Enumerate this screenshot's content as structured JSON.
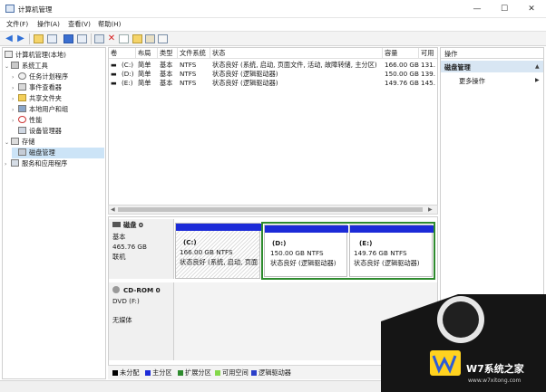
{
  "window": {
    "title": "计算机管理",
    "controls": {
      "minimize": "—",
      "maximize": "☐",
      "close": "✕"
    }
  },
  "menubar": {
    "items": [
      {
        "label": "文件(F)"
      },
      {
        "label": "操作(A)"
      },
      {
        "label": "查看(V)"
      },
      {
        "label": "帮助(H)"
      }
    ]
  },
  "toolbar": {
    "back_glyph": "◀",
    "forward_glyph": "▶",
    "delete_glyph": "✕",
    "icons": [
      "back-icon",
      "forward-icon",
      "up-folder-icon",
      "show-hide-tree-icon",
      "help-icon",
      "properties-icon",
      "connect-icon",
      "delete-icon",
      "check-icon",
      "open-icon",
      "help-book-icon",
      "view-icon"
    ]
  },
  "tree": {
    "items": [
      {
        "label": "计算机管理(本地)",
        "level": 0,
        "expander": "",
        "icon": "computer-icon",
        "selected": false
      },
      {
        "label": "系统工具",
        "level": 1,
        "expander": "⌄",
        "icon": "tools-icon",
        "selected": false
      },
      {
        "label": "任务计划程序",
        "level": 2,
        "expander": "›",
        "icon": "clock-icon",
        "selected": false
      },
      {
        "label": "事件查看器",
        "level": 2,
        "expander": "›",
        "icon": "event-icon",
        "selected": false
      },
      {
        "label": "共享文件夹",
        "level": 2,
        "expander": "›",
        "icon": "folder-icon",
        "selected": false
      },
      {
        "label": "本地用户和组",
        "level": 2,
        "expander": "›",
        "icon": "users-icon",
        "selected": false
      },
      {
        "label": "性能",
        "level": 2,
        "expander": "›",
        "icon": "performance-icon",
        "selected": false
      },
      {
        "label": "设备管理器",
        "level": 2,
        "expander": "",
        "icon": "device-icon",
        "selected": false
      },
      {
        "label": "存储",
        "level": 1,
        "expander": "⌄",
        "icon": "storage-icon",
        "selected": false
      },
      {
        "label": "磁盘管理",
        "level": 2,
        "expander": "",
        "icon": "disk-icon",
        "selected": true
      },
      {
        "label": "服务和应用程序",
        "level": 1,
        "expander": "›",
        "icon": "services-icon",
        "selected": false
      }
    ]
  },
  "volumes": {
    "columns": [
      "卷",
      "布局",
      "类型",
      "文件系统",
      "状态",
      "容量",
      "可用"
    ],
    "rows": [
      [
        "(C:)",
        "简单",
        "基本",
        "NTFS",
        "状态良好 (系统, 启动, 页面文件, 活动, 故障转储, 主分区)",
        "166.00 GB",
        "131."
      ],
      [
        "(D:)",
        "简单",
        "基本",
        "NTFS",
        "状态良好 (逻辑驱动器)",
        "150.00 GB",
        "139."
      ],
      [
        "(E:)",
        "简单",
        "基本",
        "NTFS",
        "状态良好 (逻辑驱动器)",
        "149.76 GB",
        "145."
      ]
    ]
  },
  "disks": [
    {
      "name": "磁盘 0",
      "type": "基本",
      "size": "465.76 GB",
      "status": "联机",
      "partitions": [
        {
          "letter": "(C:)",
          "size_fs": "166.00 GB NTFS",
          "status": "状态良好 (系统, 启动, 页面",
          "hatched": true,
          "bar_color": "#1c2bd8"
        },
        {
          "letter": "(D:)",
          "size_fs": "150.00 GB NTFS",
          "status": "状态良好 (逻辑驱动器)",
          "hatched": false,
          "bar_color": "#1c2bd8"
        },
        {
          "letter": "(E:)",
          "size_fs": "149.76 GB NTFS",
          "status": "状态良好 (逻辑驱动器)",
          "hatched": false,
          "bar_color": "#1c2bd8"
        }
      ]
    },
    {
      "name": "CD-ROM 0",
      "type": "DVD (F:)",
      "size": "",
      "status": "无媒体",
      "partitions": []
    }
  ],
  "legend": [
    {
      "label": "未分配",
      "color": "#000000"
    },
    {
      "label": "主分区",
      "color": "#1c2bd8"
    },
    {
      "label": "扩展分区",
      "color": "#2e8b2e"
    },
    {
      "label": "可用空间",
      "color": "#84d84a"
    },
    {
      "label": "逻辑驱动器",
      "color": "#2b3fc9"
    }
  ],
  "actions": {
    "header": "操作",
    "section": "磁盘管理",
    "section_arrow": "▲",
    "more": "更多操作",
    "more_arrow": "▶"
  },
  "watermark": {
    "brand": "W7系统之家",
    "site": "www.w7xitong.com"
  },
  "colors": {
    "primary_partition": "#1c2bd8",
    "extended_partition_border": "#2e8b2e",
    "selection": "#cce4f7",
    "action_section_bg": "#d8e6f3"
  }
}
